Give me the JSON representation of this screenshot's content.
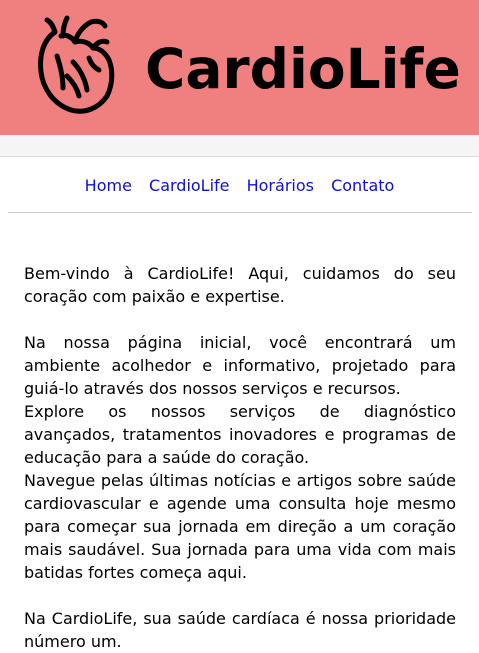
{
  "header": {
    "brand": "CardioLife",
    "background_color": "#f08080",
    "logo_icon": "anatomical-heart-icon"
  },
  "nav": {
    "link_color": "#1010d0",
    "items": [
      {
        "label": "Home"
      },
      {
        "label": "CardioLife"
      },
      {
        "label": "Horários"
      },
      {
        "label": "Contato"
      }
    ]
  },
  "main": {
    "intro": "Bem-vindo à CardioLife! Aqui, cuidamos do seu coração com paixão e expertise.",
    "p1": "Na nossa página inicial, você encontrará um ambiente acolhedor e informativo, projetado para guiá-lo através dos nossos serviços e recursos.",
    "p2": "Explore os nossos serviços de diagnóstico avançados, tratamentos inovadores e programas de educação para a saúde do coração.",
    "p3": "Navegue pelas últimas notícias e artigos sobre saúde cardiovascular e agende uma consulta hoje mesmo para começar sua jornada em direção a um coração mais saudável. Sua jornada para uma vida com mais batidas fortes começa aqui.",
    "closing": "Na CardioLife, sua saúde cardíaca é nossa prioridade número um."
  }
}
